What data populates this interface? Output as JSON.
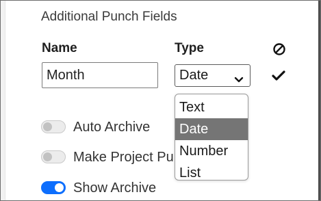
{
  "section": {
    "title": "Additional Punch Fields"
  },
  "columns": {
    "name": "Name",
    "type": "Type",
    "actions_icon": "ban-icon"
  },
  "row": {
    "name_value": "Month",
    "type_value": "Date",
    "confirm_icon": "checkmark-icon"
  },
  "type_dropdown": {
    "options": [
      "Text",
      "Date",
      "Number",
      "List"
    ],
    "selected": "Date"
  },
  "toggles": [
    {
      "label": "Auto Archive",
      "on": false
    },
    {
      "label": "Make Project Pu",
      "on": false
    },
    {
      "label": "Show Archive",
      "on": true
    }
  ],
  "colors": {
    "accent": "#0d6efd",
    "option_selected_bg": "#757575"
  }
}
